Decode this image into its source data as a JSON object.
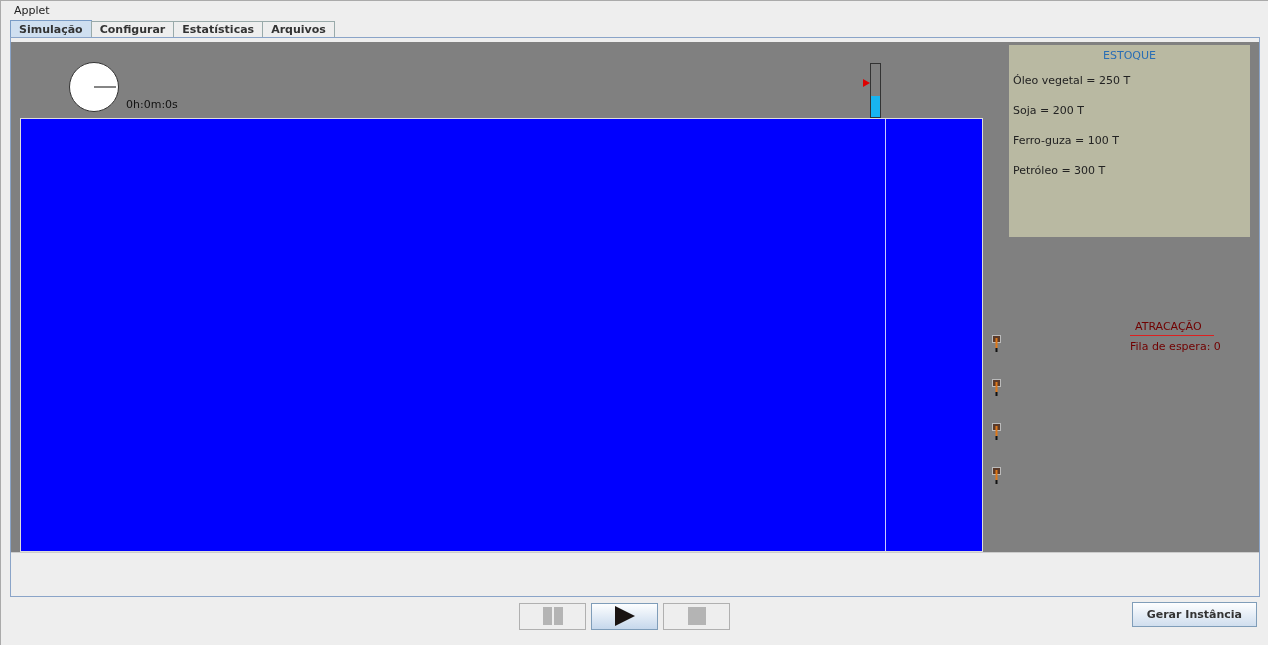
{
  "window": {
    "title": "Applet"
  },
  "tabs": [
    {
      "label": "Simulação",
      "selected": true
    },
    {
      "label": "Configurar",
      "selected": false
    },
    {
      "label": "Estatísticas",
      "selected": false
    },
    {
      "label": "Arquivos",
      "selected": false
    }
  ],
  "simulation": {
    "clock": "0h:0m:0s",
    "gauge": {
      "level": 0.4
    },
    "stock": {
      "title": "ESTOQUE",
      "items": [
        "Óleo vegetal = 250 T",
        "Soja = 200 T",
        "Ferro-guza = 100 T",
        "Petróleo = 300 T"
      ]
    },
    "berthing": {
      "title": "ATRACAÇÃO",
      "queue": "Fila de espera: 0"
    }
  },
  "controls": [
    {
      "kind": "pause",
      "disabled": true
    },
    {
      "kind": "play",
      "disabled": false
    },
    {
      "kind": "stop",
      "disabled": true
    }
  ],
  "generate_button": "Gerar Instância"
}
